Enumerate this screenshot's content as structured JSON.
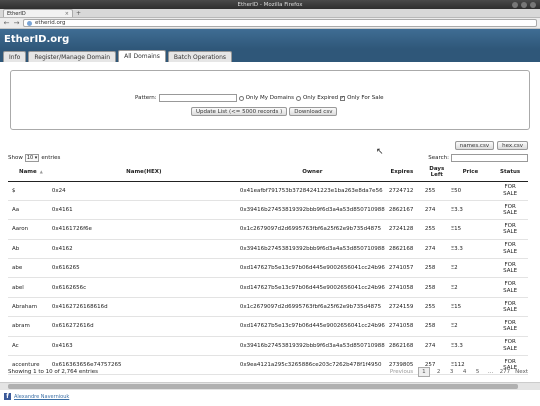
{
  "browser": {
    "window_title": "EtherID - Mozilla Firefox",
    "tab_label": "EtherID",
    "url": "etherid.org"
  },
  "site": {
    "logo": "EtherID.org",
    "tabs": [
      {
        "label": "Info",
        "active": false
      },
      {
        "label": "Register/Manage Domain",
        "active": false
      },
      {
        "label": "All Domains",
        "active": true
      },
      {
        "label": "Batch Operations",
        "active": false
      }
    ]
  },
  "filter": {
    "pattern_label": "Pattern:",
    "pattern_value": "",
    "only_my_domains": "Only My Domains",
    "only_expired": "Only Expired",
    "only_for_sale": "Only For Sale",
    "update_button": "Update List (<= 5000 records )",
    "download_button": "Download csv"
  },
  "csv_buttons": {
    "names": "names.csv",
    "hex": "hex.csv"
  },
  "controls": {
    "show": "Show",
    "entries_count": "10",
    "entries": "entries",
    "search": "Search:"
  },
  "table": {
    "headers": {
      "name": "Name",
      "hex": "Name(HEX)",
      "owner": "Owner",
      "expires": "Expires",
      "days_left": "Days Left",
      "price": "Price",
      "status": "Status"
    },
    "rows": [
      {
        "name": "$",
        "hex": "0x24",
        "owner": "0x41eafbf791753b37284241223e1ba263e8da7e56",
        "expires": "2724712",
        "days": "255",
        "price": "50",
        "status_l1": "FOR",
        "status_l2": "SALE"
      },
      {
        "name": "Aa",
        "hex": "0x4161",
        "owner": "0x39416b27453819392bbb9f6d3a4a53d850710988",
        "expires": "2862167",
        "days": "274",
        "price": "3.3",
        "status_l1": "FOR",
        "status_l2": "SALE"
      },
      {
        "name": "Aaron",
        "hex": "0x4161726f6e",
        "owner": "0x1c2679097d2d6995763fbf6a25f62e9b735d4875",
        "expires": "2724128",
        "days": "255",
        "price": "15",
        "status_l1": "FOR",
        "status_l2": "SALE"
      },
      {
        "name": "Ab",
        "hex": "0x4162",
        "owner": "0x39416b27453819392bbb9f6d3a4a53d850710988",
        "expires": "2862168",
        "days": "274",
        "price": "3.3",
        "status_l1": "FOR",
        "status_l2": "SALE"
      },
      {
        "name": "abe",
        "hex": "0x616265",
        "owner": "0xd147627b5e13c97b06d445e9002656041cc24b96",
        "expires": "2741057",
        "days": "258",
        "price": "2",
        "status_l1": "FOR",
        "status_l2": "SALE"
      },
      {
        "name": "abel",
        "hex": "0x6162656c",
        "owner": "0xd147627b5e13c97b06d445e9002656041cc24b96",
        "expires": "2741058",
        "days": "258",
        "price": "2",
        "status_l1": "FOR",
        "status_l2": "SALE"
      },
      {
        "name": "Abraham",
        "hex": "0x4162726168616d",
        "owner": "0x1c2679097d2d6995763fbf6a25f62e9b735d4875",
        "expires": "2724159",
        "days": "255",
        "price": "15",
        "status_l1": "FOR",
        "status_l2": "SALE"
      },
      {
        "name": "abram",
        "hex": "0x616272616d",
        "owner": "0xd147627b5e13c97b06d445e9002656041cc24b96",
        "expires": "2741058",
        "days": "258",
        "price": "2",
        "status_l1": "FOR",
        "status_l2": "SALE"
      },
      {
        "name": "Ac",
        "hex": "0x4163",
        "owner": "0x39416b27453819392bbb9f6d3a4a53d850710988",
        "expires": "2862168",
        "days": "274",
        "price": "3.3",
        "status_l1": "FOR",
        "status_l2": "SALE"
      },
      {
        "name": "accenture",
        "hex": "0x616363656e74757265",
        "owner": "0x9ea4121a295c3265886ce203c7262b478f1f4950",
        "expires": "2739805",
        "days": "257",
        "price": "112",
        "status_l1": "FOR",
        "status_l2": "SALE"
      }
    ]
  },
  "pagination": {
    "info": "Showing 1 to 10 of 2,764 entries",
    "previous": "Previous",
    "pages": [
      "1",
      "2",
      "3",
      "4",
      "5"
    ],
    "ellipsis": "…",
    "last": "277",
    "next": "Next"
  },
  "footer": {
    "link": "Alexandre Naverniouk"
  },
  "icons": {
    "currency": "eth-icon",
    "facebook": "facebook-icon",
    "globe": "globe-icon"
  },
  "colors": {
    "site_header": "#2f5779",
    "link": "#3a6ea5"
  }
}
